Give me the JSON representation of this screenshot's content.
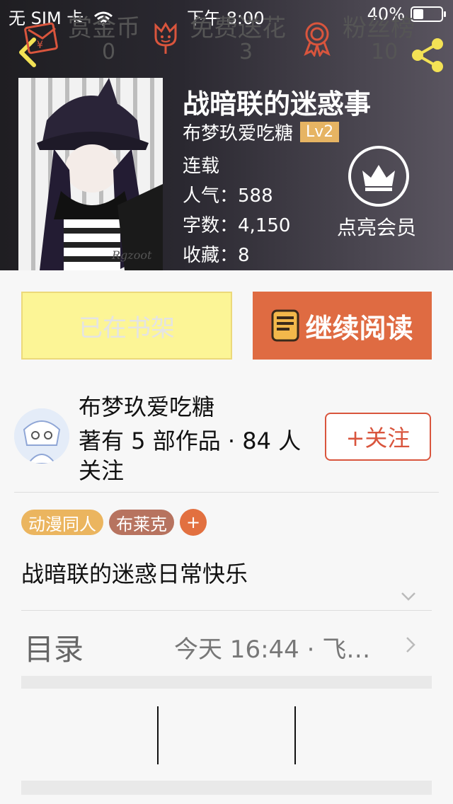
{
  "status_bar": {
    "carrier": "无 SIM 卡",
    "time": "下午 8:00",
    "battery": "40%"
  },
  "book": {
    "title": "战暗联的迷惑事",
    "author": "布梦玖爱吃糖",
    "level": "Lv2",
    "status": "连载",
    "popularity_label": "人气：",
    "popularity": "588",
    "words_label": "字数：",
    "words": "4,150",
    "favorites_label": "收藏：",
    "favorites": "8",
    "cover_signature": "Rgzoot"
  },
  "vip": {
    "label": "点亮会员"
  },
  "buttons": {
    "shelf": "已在书架",
    "read": "继续阅读"
  },
  "author_card": {
    "name": "布梦玖爱吃糖",
    "info": "著有 5 部作品 · 84 人关注",
    "follow": "+关注"
  },
  "tags": [
    "动漫同人",
    "布莱克"
  ],
  "tag_add": "+",
  "description": "战暗联的迷惑日常快乐",
  "toc": {
    "label": "目录",
    "latest": "今天 16:44 · 飞…"
  },
  "actions": [
    {
      "label": "赏金币",
      "count": "0",
      "icon": "red-envelope-icon"
    },
    {
      "label": "免费送花",
      "count": "3",
      "icon": "flower-icon"
    },
    {
      "label": "粉丝榜",
      "count": "10",
      "icon": "medal-icon"
    }
  ],
  "colors": {
    "accent": "#df6b42",
    "shelf_bg": "#fcf596",
    "level_badge": "#e6b463"
  }
}
